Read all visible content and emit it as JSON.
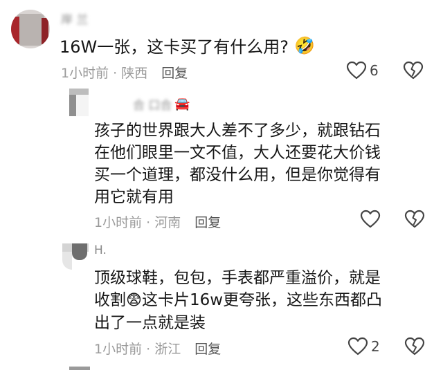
{
  "comments": [
    {
      "username": "岸 兰",
      "text": "16W一张，这卡买了有什么用?",
      "emoji": "🤣",
      "time": "1小时前",
      "location": "陕西",
      "reply_label": "回复",
      "like_count": "6"
    },
    {
      "username": "合 口合",
      "username_emoji": "🚘",
      "lines": [
        "孩子的世界跟大人差不了多少，就跟钻石",
        "在他们眼里一文不值，大人还要花大价钱",
        "买一个道理，都没什么用，但是你觉得有",
        "用它就有用"
      ],
      "time": "1小时前",
      "location": "河南",
      "reply_label": "回复"
    },
    {
      "username": "H.",
      "line1": "顶级球鞋，包包，手表都严重溢价，就是",
      "line2_prefix": "收割",
      "line2_emoji": "😨",
      "line2_suffix": "这卡片16w更夸张，这些东西都凸",
      "line3": "出了一点就是装",
      "time": "1小时前",
      "location": "浙江",
      "reply_label": "回复",
      "like_count": "2"
    }
  ],
  "icons": {
    "like": "heart-outline-icon",
    "dislike": "broken-heart-outline-icon"
  },
  "colors": {
    "text": "#161616",
    "meta": "#9a9a9a",
    "username": "#8a8a8a"
  }
}
